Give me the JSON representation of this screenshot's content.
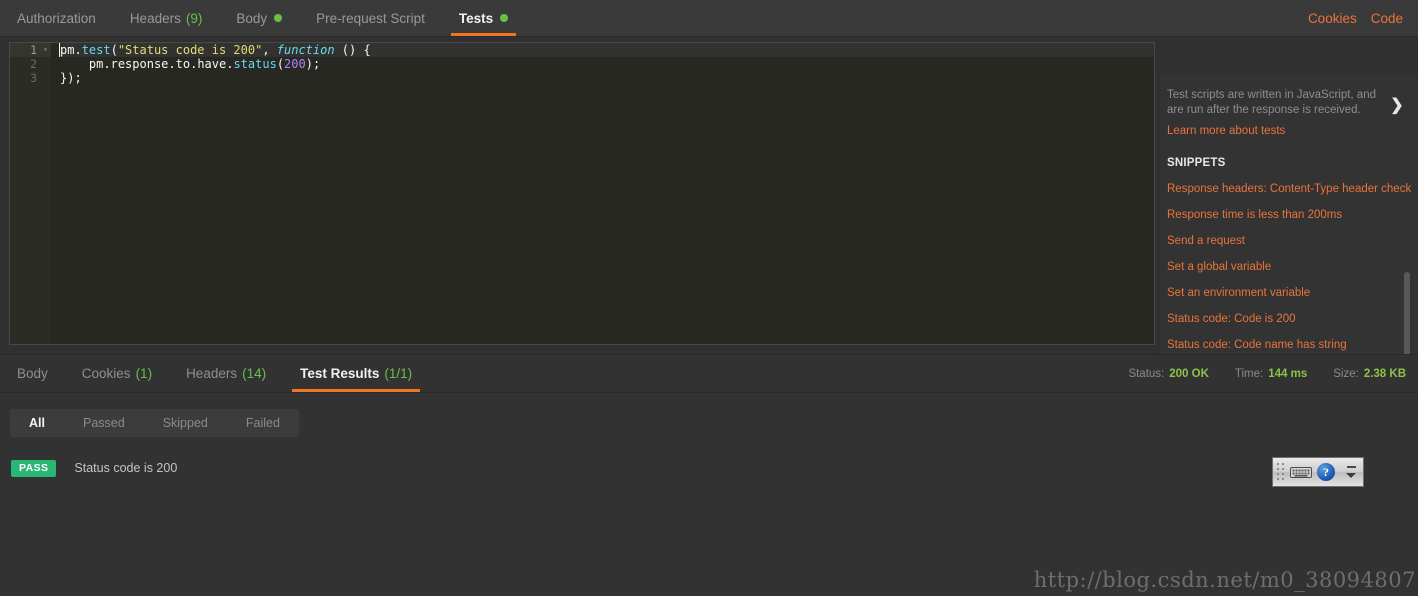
{
  "request_tabs": {
    "items": [
      {
        "label": "Authorization",
        "count": null,
        "dot": false,
        "active": false
      },
      {
        "label": "Headers",
        "count": "(9)",
        "dot": false,
        "active": false
      },
      {
        "label": "Body",
        "count": null,
        "dot": true,
        "active": false
      },
      {
        "label": "Pre-request Script",
        "count": null,
        "dot": false,
        "active": false
      },
      {
        "label": "Tests",
        "count": null,
        "dot": true,
        "active": true
      }
    ],
    "actions": [
      {
        "label": "Cookies"
      },
      {
        "label": "Code"
      }
    ]
  },
  "editor": {
    "line_numbers": [
      "1",
      "2",
      "3"
    ],
    "fold_glyph": "▾",
    "lines": [
      [
        {
          "t": "pm",
          "c": "plain"
        },
        {
          "t": ".",
          "c": "punc"
        },
        {
          "t": "test",
          "c": "prop"
        },
        {
          "t": "(",
          "c": "punc"
        },
        {
          "t": "\"Status code is 200\"",
          "c": "str"
        },
        {
          "t": ", ",
          "c": "punc"
        },
        {
          "t": "function",
          "c": "kw"
        },
        {
          "t": " () {",
          "c": "punc"
        }
      ],
      [
        {
          "t": "    pm",
          "c": "plain"
        },
        {
          "t": ".",
          "c": "punc"
        },
        {
          "t": "response",
          "c": "plain"
        },
        {
          "t": ".",
          "c": "punc"
        },
        {
          "t": "to",
          "c": "plain"
        },
        {
          "t": ".",
          "c": "punc"
        },
        {
          "t": "have",
          "c": "plain"
        },
        {
          "t": ".",
          "c": "punc"
        },
        {
          "t": "status",
          "c": "prop"
        },
        {
          "t": "(",
          "c": "punc"
        },
        {
          "t": "200",
          "c": "num"
        },
        {
          "t": ");",
          "c": "punc"
        }
      ],
      [
        {
          "t": "});",
          "c": "punc"
        }
      ]
    ]
  },
  "snippets_sidebar": {
    "help_text": "Test scripts are written in JavaScript, and are run after the response is received.",
    "learn_more": "Learn more about tests",
    "section_title": "SNIPPETS",
    "chevron": "❯",
    "items": [
      "Response headers: Content-Type header check",
      "Response time is less than 200ms",
      "Send a request",
      "Set a global variable",
      "Set an environment variable",
      "Status code: Code is 200",
      "Status code: Code name has string"
    ]
  },
  "response": {
    "tabs": [
      {
        "label": "Body",
        "count": null,
        "active": false
      },
      {
        "label": "Cookies",
        "count": "(1)",
        "active": false
      },
      {
        "label": "Headers",
        "count": "(14)",
        "active": false
      },
      {
        "label": "Test Results",
        "count": "(1/1)",
        "active": true
      }
    ],
    "meta": [
      {
        "label": "Status:",
        "value": "200 OK"
      },
      {
        "label": "Time:",
        "value": "144 ms"
      },
      {
        "label": "Size:",
        "value": "2.38 KB"
      }
    ],
    "filters": [
      {
        "label": "All",
        "active": true
      },
      {
        "label": "Passed",
        "active": false
      },
      {
        "label": "Skipped",
        "active": false
      },
      {
        "label": "Failed",
        "active": false
      }
    ],
    "results": [
      {
        "status": "PASS",
        "name": "Status code is 200"
      }
    ]
  },
  "ime_toolbar": {
    "help_glyph": "?"
  },
  "watermark": {
    "text": "http://blog.csdn.net/m0_38094807"
  },
  "colors": {
    "accent_orange": "#f07525",
    "link_orange": "#e8743b",
    "green": "#6abf4b",
    "meta_green": "#8bc34a",
    "pass_green": "#2ab673",
    "editor_bg": "#272822",
    "panel_bg": "#323232",
    "tabbar_bg": "#3a3a3a"
  }
}
